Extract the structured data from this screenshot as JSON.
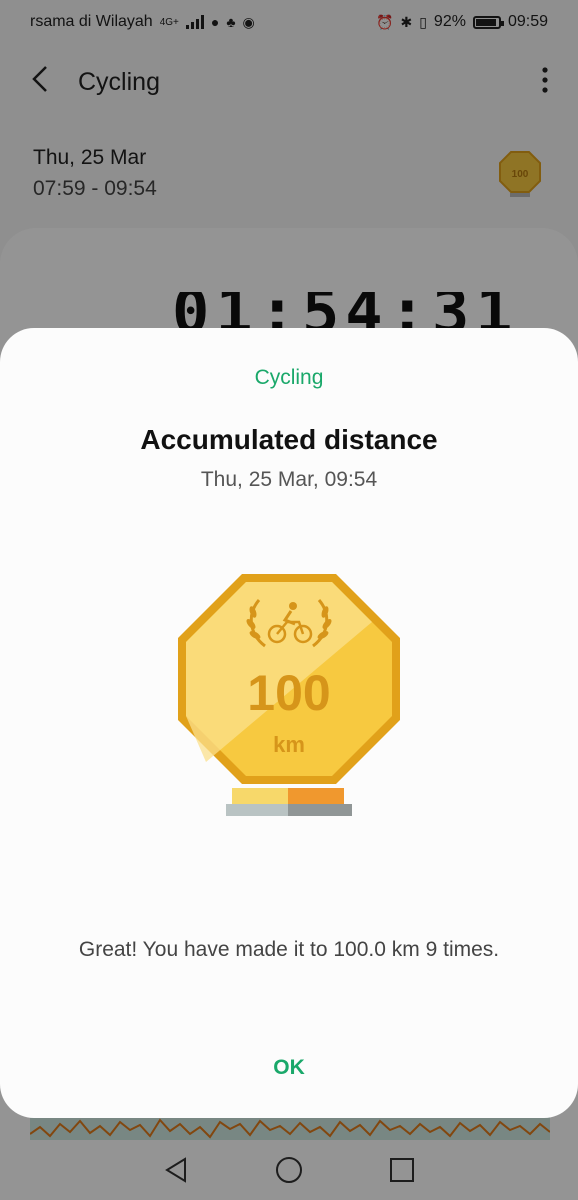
{
  "status_bar": {
    "carrier": "rsama di Wilayah",
    "network": "4G+",
    "battery_percent": "92%",
    "battery_level": 0.92,
    "time": "09:59"
  },
  "header": {
    "title": "Cycling"
  },
  "session": {
    "date": "Thu, 25 Mar",
    "time_range": "07:59 - 09:54",
    "duration": "01:54:31"
  },
  "dialog": {
    "category": "Cycling",
    "title": "Accumulated distance",
    "datetime": "Thu, 25 Mar, 09:54",
    "badge": {
      "value": "100",
      "unit": "km",
      "icon": "cyclist-laurel-icon"
    },
    "message": "Great! You have made it to 100.0 km 9 times.",
    "ok_label": "OK"
  },
  "colors": {
    "accent_green": "#1aa86a",
    "badge_gold": "#f7c940",
    "badge_dark": "#e1a11a",
    "badge_text": "#d6951a"
  }
}
